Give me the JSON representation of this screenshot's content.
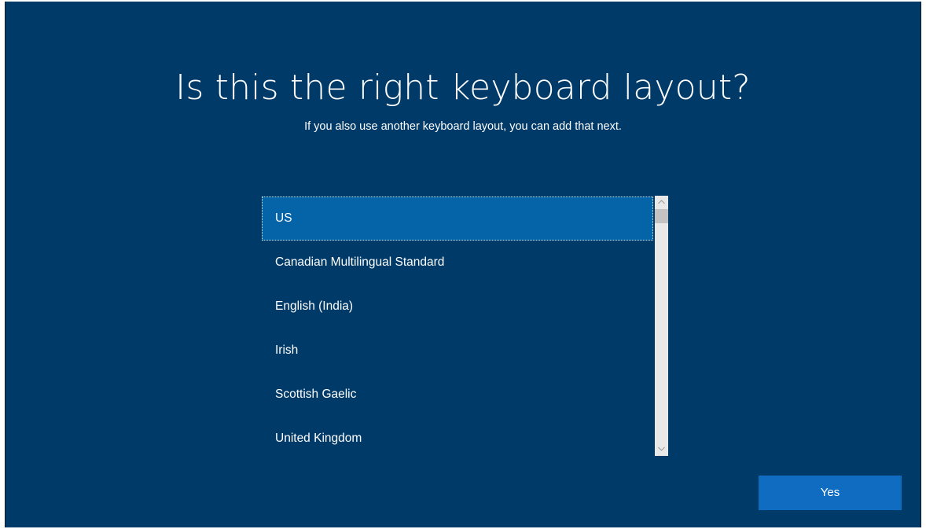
{
  "page": {
    "title": "Is this the right keyboard layout?",
    "subtitle": "If you also use another keyboard layout, you can add that next."
  },
  "keyboard_layouts": {
    "selected": "US",
    "items": [
      {
        "label": "US"
      },
      {
        "label": "Canadian Multilingual Standard"
      },
      {
        "label": "English (India)"
      },
      {
        "label": "Irish"
      },
      {
        "label": "Scottish Gaelic"
      },
      {
        "label": "United Kingdom"
      }
    ],
    "scrollbar": {
      "up_icon": "chevron-up-icon",
      "down_icon": "chevron-down-icon"
    }
  },
  "actions": {
    "yes_label": "Yes"
  },
  "colors": {
    "background": "#003a68",
    "selected_item": "#0563a8",
    "button": "#0f6cc1",
    "text": "#ffffff"
  }
}
